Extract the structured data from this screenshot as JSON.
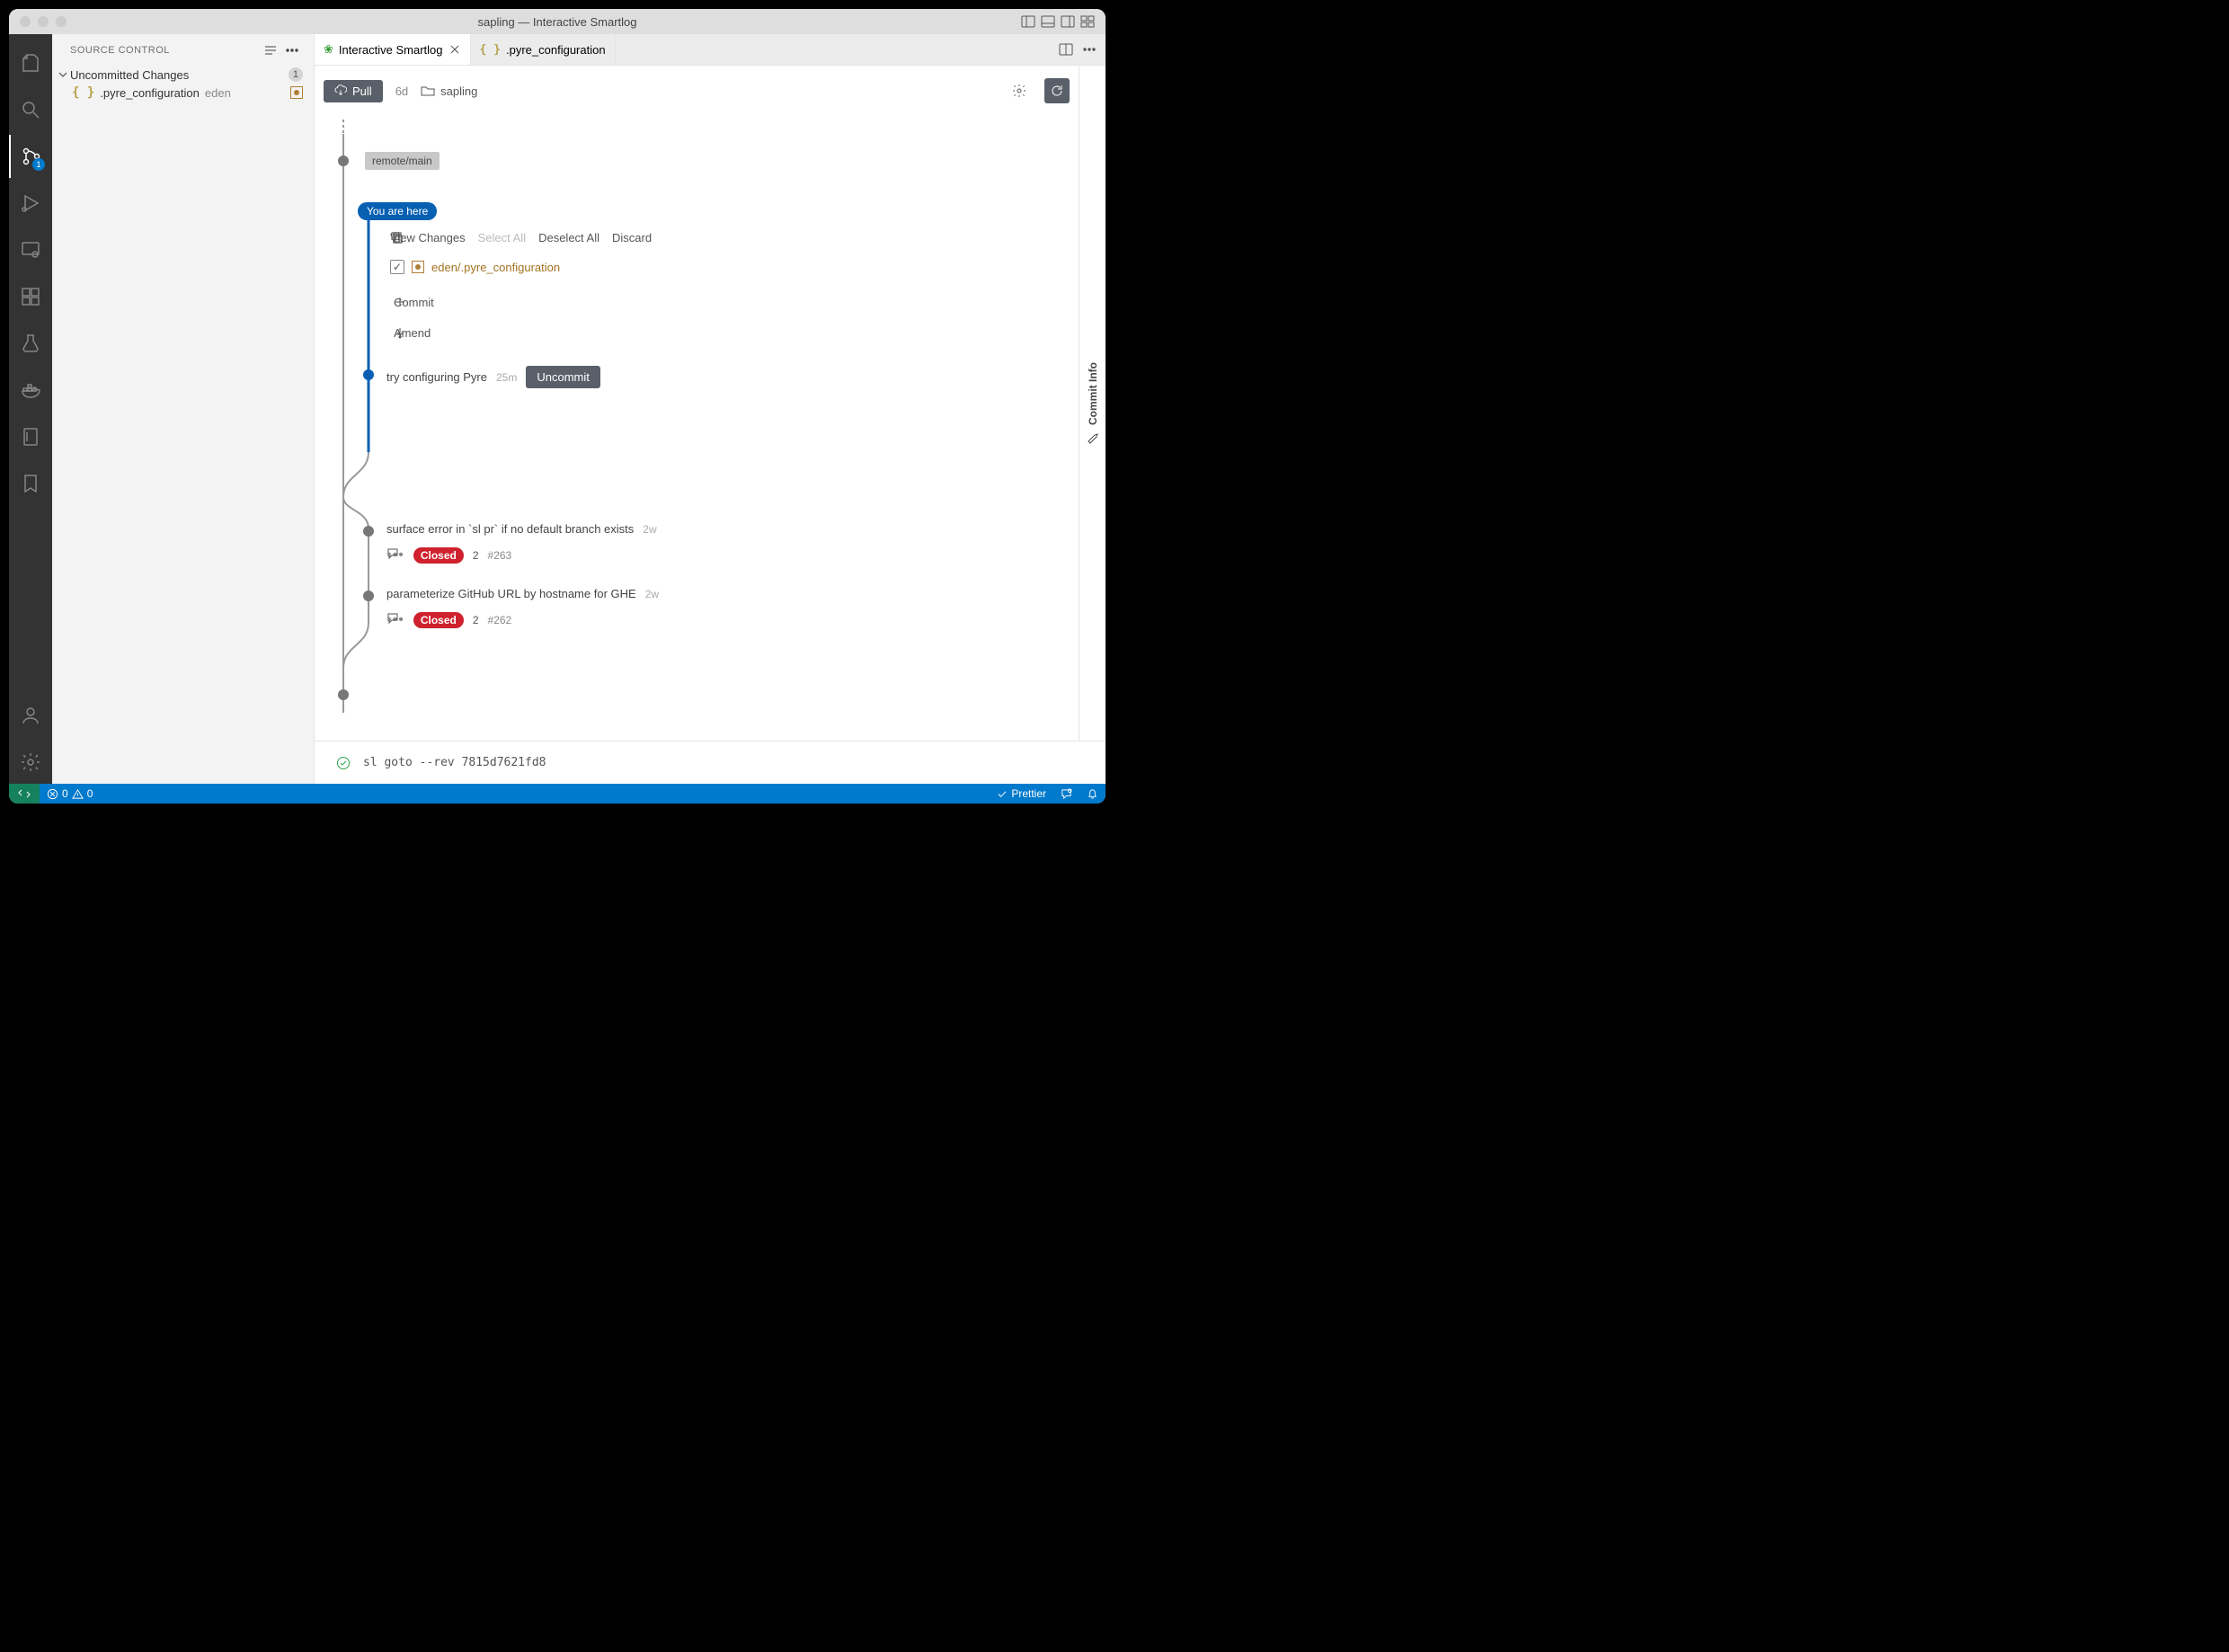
{
  "title": "sapling — Interactive Smartlog",
  "sidebar": {
    "title": "SOURCE CONTROL",
    "section": {
      "label": "Uncommitted Changes",
      "count": "1"
    },
    "file": {
      "name": ".pyre_configuration",
      "dir": "eden"
    }
  },
  "tabs": [
    {
      "label": "Interactive Smartlog",
      "icon": "leaf",
      "active": true,
      "closable": true
    },
    {
      "label": ".pyre_configuration",
      "icon": "braces",
      "active": false,
      "closable": false
    }
  ],
  "toolbar": {
    "pull": "Pull",
    "pull_age": "6d",
    "cwd": "sapling"
  },
  "graph": {
    "remote_tag": "remote/main",
    "here": "You are here",
    "actions": {
      "view": "View Changes",
      "select_all": "Select All",
      "deselect_all": "Deselect All",
      "discard": "Discard"
    },
    "changed_file": "eden/.pyre_configuration",
    "commit_label": "Commit",
    "amend_label": "Amend",
    "commits": [
      {
        "msg": "try configuring Pyre",
        "ago": "25m",
        "uncommit": "Uncommit"
      },
      {
        "msg": "surface error in `sl pr` if no default branch exists",
        "ago": "2w",
        "closed": "Closed",
        "comments": "2",
        "pr": "#263"
      },
      {
        "msg": "parameterize GitHub URL by hostname for GHE",
        "ago": "2w",
        "closed": "Closed",
        "comments": "2",
        "pr": "#262"
      }
    ]
  },
  "commit_info_rail": "Commit Info",
  "terminal": "sl goto --rev 7815d7621fd8",
  "statusbar": {
    "errors": "0",
    "warnings": "0",
    "prettier": "Prettier"
  },
  "activity_badge": "1"
}
